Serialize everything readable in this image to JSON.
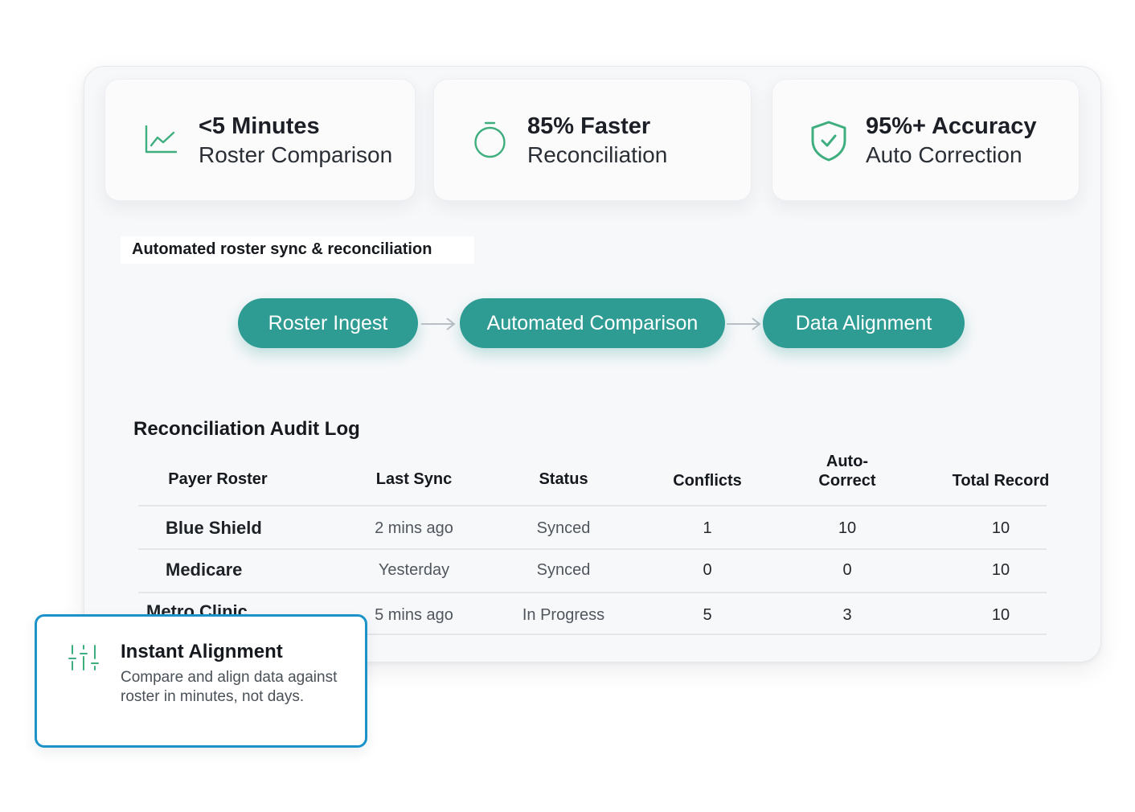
{
  "stats": [
    {
      "title": "<5 Minutes",
      "subtitle": "Roster Comparison",
      "icon": "line-chart-icon"
    },
    {
      "title": "85% Faster",
      "subtitle": "Reconciliation",
      "icon": "stopwatch-icon"
    },
    {
      "title": "95%+ Accuracy",
      "subtitle": "Auto Correction",
      "icon": "shield-check-icon"
    }
  ],
  "flow": {
    "label": "Automated roster sync & reconciliation",
    "steps": [
      "Roster Ingest",
      "Automated Comparison",
      "Data Alignment"
    ]
  },
  "audit_log": {
    "title": "Reconciliation Audit Log",
    "columns": [
      "Payer Roster",
      "Last Sync",
      "Status",
      "Conflicts",
      "Auto-",
      "Correct",
      "Total Record"
    ],
    "rows": [
      {
        "payer": "Blue Shield",
        "last_sync": "2 mins ago",
        "status": "Synced",
        "conflicts": "1",
        "auto_correct": "10",
        "total": "10"
      },
      {
        "payer": "Medicare",
        "last_sync": "Yesterday",
        "status": "Synced",
        "conflicts": "0",
        "auto_correct": "0",
        "total": "10"
      },
      {
        "payer": "Metro Clinic",
        "last_sync": "5 mins ago",
        "status": "In Progress",
        "conflicts": "5",
        "auto_correct": "3",
        "total": "10"
      }
    ]
  },
  "callout": {
    "title": "Instant Alignment",
    "text": "Compare and align data against roster in minutes, not days.",
    "icon": "sliders-icon"
  },
  "colors": {
    "accent": "#2f9c94",
    "icon_green": "#3fae7e",
    "callout_border": "#1b93c9"
  }
}
